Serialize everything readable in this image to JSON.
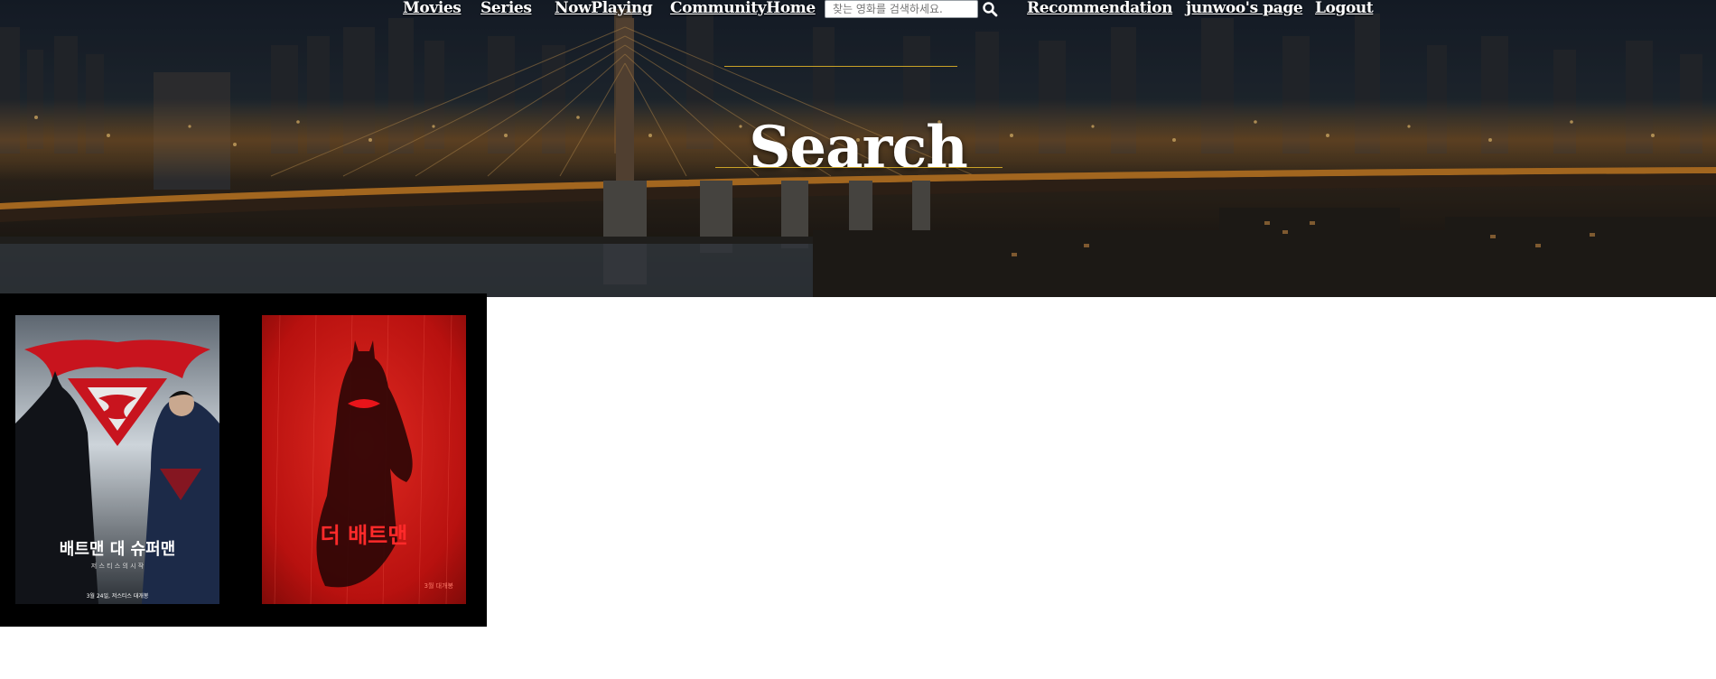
{
  "nav": {
    "movies": "Movies",
    "series": "Series",
    "now_playing": "NowPlaying",
    "community_home": "CommunityHome",
    "search_placeholder": "찾는 영화를 검색하세요.",
    "recommendation": "Recommendation",
    "user_page": "junwoo's page",
    "logout": "Logout"
  },
  "page_title": "Search",
  "colors": {
    "accent_rule": "#c9a227",
    "results_bg": "#000000"
  },
  "results": [
    {
      "title_art": "배트맨 대 슈퍼맨",
      "subtitle_art": "저 스 티 스 의 시 작",
      "release_art": "3월 24일, 저스티스 대개봉"
    },
    {
      "title_art": "더 배트맨",
      "release_art": "3월 대개봉"
    }
  ]
}
